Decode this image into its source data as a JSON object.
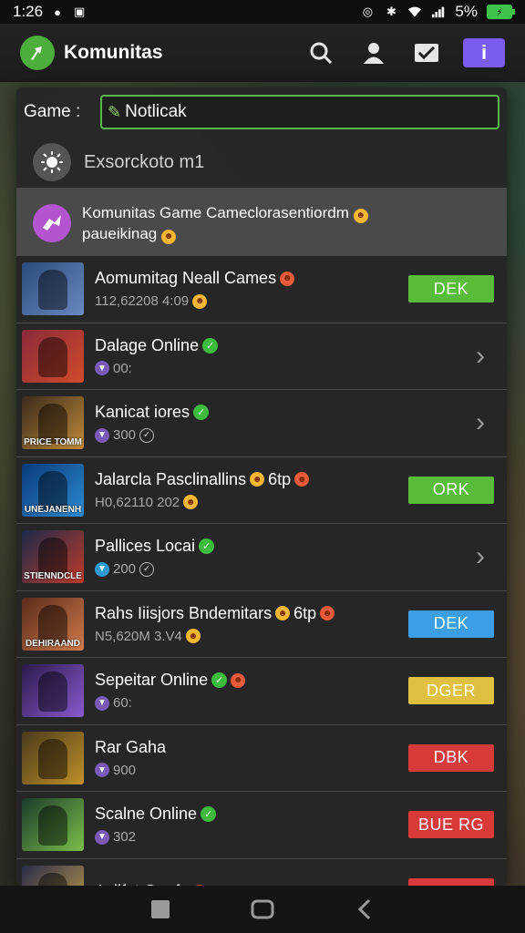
{
  "status": {
    "time": "1:26",
    "battery": "5%"
  },
  "app": {
    "title": "Komunitas"
  },
  "filter": {
    "label": "Game",
    "separator": ":",
    "value": "Notlicak"
  },
  "suggestion": {
    "text": "Exsorckoto m1"
  },
  "highlight": {
    "line1": "Komunitas Game Cameclorasentiordm",
    "line2": "paueikinag"
  },
  "games": [
    {
      "title": "Aomumitag Neall Cames",
      "sub": "112,62208 4:09",
      "action": "DEK",
      "action_color": "#58bb3a",
      "thumb": [
        "#2a4a7a",
        "#6a8ac0"
      ],
      "caption": "",
      "verified": false,
      "title_emoji": true,
      "sub_token": "",
      "sub_ring": false,
      "sub_emoji": true
    },
    {
      "title": "Dalage Online",
      "sub": "00:",
      "action": "",
      "action_color": "",
      "thumb": [
        "#8a2a3a",
        "#d04a2a"
      ],
      "caption": "",
      "verified": true,
      "title_emoji": false,
      "sub_token": "purple",
      "sub_ring": false,
      "sub_emoji": false
    },
    {
      "title": "Kanicat iores",
      "sub": "300",
      "action": "",
      "action_color": "",
      "thumb": [
        "#3a2a1a",
        "#c08a3a"
      ],
      "caption": "PRICE TOMM",
      "verified": true,
      "title_emoji": false,
      "sub_token": "purple",
      "sub_ring": true,
      "sub_emoji": false
    },
    {
      "title": "Jalarcla Pasclinallins",
      "sub": "H0,62110 202",
      "suffix": "6tp",
      "action": "ORK",
      "action_color": "#58bb3a",
      "thumb": [
        "#0a3a7a",
        "#2a8ad0"
      ],
      "caption": "UNEJANENH",
      "verified": false,
      "title_emoji": true,
      "sub_token": "",
      "sub_ring": false,
      "sub_emoji": true
    },
    {
      "title": "Pallices Locai",
      "sub": "200",
      "action": "",
      "action_color": "",
      "thumb": [
        "#1a2a4a",
        "#c03a2a"
      ],
      "caption": "STIENNDCLE",
      "verified": true,
      "title_emoji": false,
      "sub_token": "blue",
      "sub_ring": true,
      "sub_emoji": false
    },
    {
      "title": "Rahs Iiisjors Bndemitars",
      "sub": "N5,620M 3.V4",
      "suffix": "6tp",
      "action": "DEK",
      "action_color": "#3d9ee8",
      "thumb": [
        "#5a2a1a",
        "#d07a4a"
      ],
      "caption": "DEHIRAAND",
      "verified": false,
      "title_emoji": true,
      "sub_token": "",
      "sub_ring": false,
      "sub_emoji": true
    },
    {
      "title": "Sepeitar Online",
      "sub": "60:",
      "action": "DGER",
      "action_color": "#e0c040",
      "thumb": [
        "#2a1a4a",
        "#8a5ad0"
      ],
      "caption": "",
      "verified": true,
      "title_emoji": true,
      "sub_token": "purple",
      "sub_ring": false,
      "sub_emoji": false
    },
    {
      "title": "Rar Gaha",
      "sub": "900",
      "action": "DBK",
      "action_color": "#d83a3a",
      "thumb": [
        "#4a3a1a",
        "#c0902a"
      ],
      "caption": "",
      "verified": false,
      "title_emoji": false,
      "sub_token": "purple",
      "sub_ring": false,
      "sub_emoji": false
    },
    {
      "title": "Scalne Online",
      "sub": "302",
      "action": "BUE RG",
      "action_color": "#d83a3a",
      "thumb": [
        "#1a3a2a",
        "#7ac04a"
      ],
      "caption": "",
      "verified": true,
      "title_emoji": false,
      "sub_token": "purple",
      "sub_ring": false,
      "sub_emoji": false
    },
    {
      "title": "Aziifat Onufa",
      "sub": "",
      "action": "",
      "action_color": "#d83a3a",
      "thumb": [
        "#2a2a4a",
        "#c0a04a"
      ],
      "caption": "",
      "verified": false,
      "title_emoji": true,
      "sub_token": "",
      "sub_ring": false,
      "sub_emoji": false
    }
  ]
}
